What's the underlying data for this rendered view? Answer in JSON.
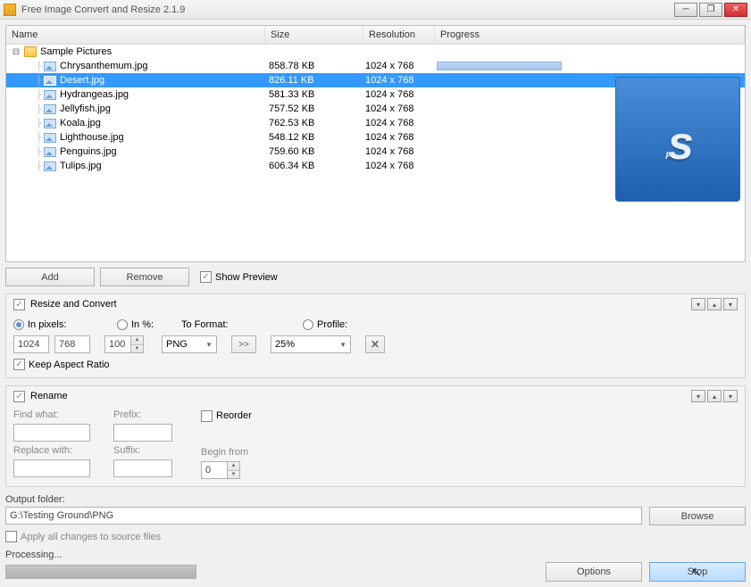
{
  "window": {
    "title": "Free Image Convert and Resize 2.1.9",
    "min": "─",
    "max": "❐",
    "close": "✕"
  },
  "columns": {
    "name": "Name",
    "size": "Size",
    "resolution": "Resolution",
    "progress": "Progress"
  },
  "root": {
    "label": "Sample Pictures"
  },
  "files": [
    {
      "name": "Chrysanthemum.jpg",
      "size": "858.78 KB",
      "res": "1024 x 768",
      "progress": true,
      "selected": false
    },
    {
      "name": "Desert.jpg",
      "size": "826.11 KB",
      "res": "1024 x 768",
      "progress": false,
      "selected": true
    },
    {
      "name": "Hydrangeas.jpg",
      "size": "581.33 KB",
      "res": "1024 x 768",
      "progress": false,
      "selected": false
    },
    {
      "name": "Jellyfish.jpg",
      "size": "757.52 KB",
      "res": "1024 x 768",
      "progress": false,
      "selected": false
    },
    {
      "name": "Koala.jpg",
      "size": "762.53 KB",
      "res": "1024 x 768",
      "progress": false,
      "selected": false
    },
    {
      "name": "Lighthouse.jpg",
      "size": "548.12 KB",
      "res": "1024 x 768",
      "progress": false,
      "selected": false
    },
    {
      "name": "Penguins.jpg",
      "size": "759.60 KB",
      "res": "1024 x 768",
      "progress": false,
      "selected": false
    },
    {
      "name": "Tulips.jpg",
      "size": "606.34 KB",
      "res": "1024 x 768",
      "progress": false,
      "selected": false
    }
  ],
  "buttons": {
    "add": "Add",
    "remove": "Remove",
    "show_preview": "Show Preview"
  },
  "resize": {
    "title": "Resize and Convert",
    "in_pixels": "In pixels:",
    "in_percent": "In %:",
    "to_format": "To Format:",
    "profile": "Profile:",
    "width": "1024",
    "height": "768",
    "percent": "100",
    "format": "PNG",
    "arrow": ">>",
    "profile_val": "25%",
    "keep_aspect": "Keep Aspect Ratio"
  },
  "rename": {
    "title": "Rename",
    "find": "Find what:",
    "replace": "Replace with:",
    "prefix": "Prefix:",
    "suffix": "Suffix:",
    "reorder": "Reorder",
    "begin": "Begin from",
    "begin_val": "0"
  },
  "output": {
    "label": "Output folder:",
    "path": "G:\\Testing Ground\\PNG",
    "browse": "Browse",
    "apply_all": "Apply all changes to source files"
  },
  "bottom": {
    "processing": "Processing...",
    "options": "Options",
    "stop": "Stop"
  },
  "logo": {
    "f": "F",
    "s": "s"
  },
  "checkmark": "✓"
}
